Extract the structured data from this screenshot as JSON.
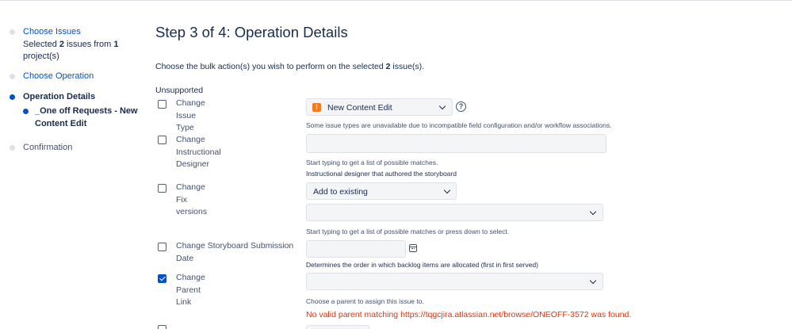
{
  "sidebar": {
    "steps": [
      {
        "label": "Choose Issues",
        "detail_prefix": "Selected ",
        "detail_count_issues": "2",
        "detail_mid": " issues from ",
        "detail_count_projects": "1",
        "detail_suffix": " project(s)"
      },
      {
        "label": "Choose Operation"
      },
      {
        "label": "Operation Details",
        "sub_label": "_One off Requests - New Content Edit"
      },
      {
        "label": "Confirmation"
      }
    ]
  },
  "main": {
    "title": "Step 3 of 4: Operation Details",
    "intro_prefix": "Choose the bulk action(s) you wish to perform on the selected ",
    "intro_count": "2",
    "intro_suffix": " issue(s).",
    "section_label": "Unsupported",
    "fields": {
      "issue_type": {
        "label": "Change Issue Type",
        "checked": false,
        "value": "New Content Edit",
        "icon": "issue-type-icon",
        "help": "Some issue types are unavailable due to incompatible field configuration and/or workflow associations."
      },
      "designer": {
        "label": "Change Instructional Designer",
        "checked": false,
        "value": "",
        "help_1": "Start typing to get a list of possible matches.",
        "help_2": "Instructional designer that authored the storyboard"
      },
      "fix_versions": {
        "label": "Change Fix versions",
        "checked": false,
        "mode": "Add to existing",
        "value": "",
        "help": "Start typing to get a list of possible matches or press down to select."
      },
      "submission_date": {
        "label": "Change Storyboard Submission Date",
        "checked": false,
        "value": "",
        "help": "Determines the order in which backlog items are allocated (first in first served)"
      },
      "parent_link": {
        "label": "Change Parent Link",
        "checked": true,
        "value": "",
        "help": "Choose a parent to assign this issue to.",
        "error": "No valid parent matching https://tqgcjira.atlassian.net/browse/ONEOFF-3572 was found."
      }
    }
  }
}
